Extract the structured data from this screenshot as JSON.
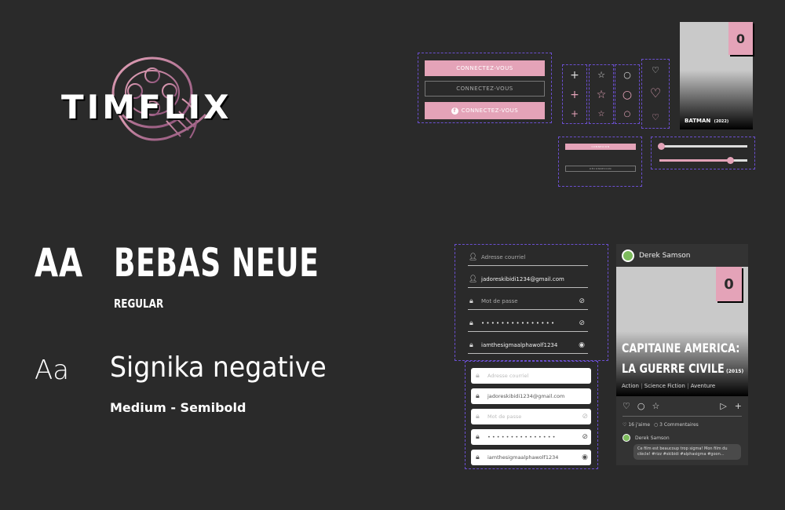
{
  "logo": {
    "text": "TIMFLIX",
    "icon": "film-reel-icon"
  },
  "typography": {
    "primary": {
      "sample": "AA",
      "name": "BEBAS NEUE",
      "weight": "REGULAR"
    },
    "secondary": {
      "sample": "Aa",
      "name": "Signika negative",
      "weight": "Medium - Semibold"
    }
  },
  "buttons": {
    "primary": "CONNECTEZ-VOUS",
    "secondary": "CONNECTEZ-VOUS",
    "facebook": "CONNECTEZ-VOUS",
    "small_primary": "CONNEXION",
    "small_secondary": "DÉCONNEXION"
  },
  "poster_small": {
    "badge": "0",
    "title": "BATMAN",
    "year": "(2022)"
  },
  "form_dark": {
    "fields": [
      {
        "value": "Adresse courriel",
        "icon": "user-icon"
      },
      {
        "value": "jadoreskibidi1234@gmail.com",
        "icon": "user-icon"
      },
      {
        "value": "Mot de passe",
        "icon": "lock-icon",
        "trail": "eye-off-icon"
      },
      {
        "value": "• • • • • • • • • • • • • • •",
        "icon": "lock-icon",
        "trail": "eye-off-icon"
      },
      {
        "value": "iamthesigmaalphawolf1234",
        "icon": "lock-icon",
        "trail": "eye-icon"
      }
    ]
  },
  "form_light": {
    "fields": [
      {
        "value": "Adresse courriel",
        "icon": "user-icon"
      },
      {
        "value": "jadoreskibidi1234@gmail.com",
        "icon": "user-icon"
      },
      {
        "value": "Mot de passe",
        "icon": "lock-icon",
        "trail": "eye-off-icon"
      },
      {
        "value": "• • • • • • • • • • • • • • •",
        "icon": "lock-icon",
        "trail": "eye-off-icon"
      },
      {
        "value": "iamthesigmaalphawolf1234",
        "icon": "lock-icon",
        "trail": "eye-icon"
      }
    ]
  },
  "card": {
    "author": "Derek Samson",
    "badge": "0",
    "title_line1": "CAPITAINE AMERICA:",
    "title_line2": "LA GUERRE CIVILE",
    "year": "(2015)",
    "genres": [
      "Action",
      "Science Fiction",
      "Aventure"
    ],
    "likes": "16 j'aime",
    "comments": "3 Commentaires",
    "comment_author": "Derek Samson",
    "comment_text": "Ce film est beaucoup trop sigma! Mon film du cIècle! #rizz #skibidi #alphasigma #goon..."
  },
  "colors": {
    "accent": "#e4a3b8",
    "background": "#2a2a2a",
    "dashed": "#6b4fd0"
  }
}
